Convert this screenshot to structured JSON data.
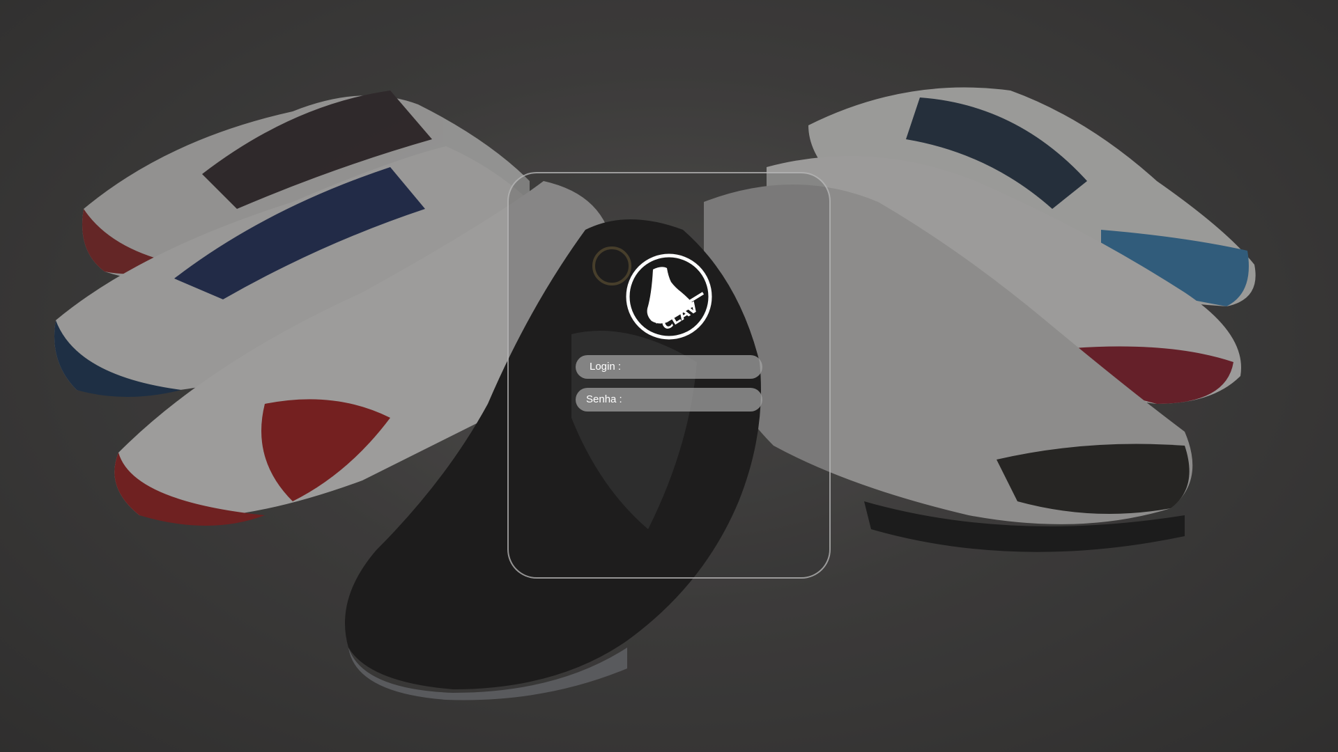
{
  "background": {
    "description_icon": "sneakers-background-image"
  },
  "brand": {
    "logo_text": "CLAV",
    "logo_icon": "sneaker-icon"
  },
  "form": {
    "login_label": "Login :",
    "login_value": "",
    "senha_label": "Senha :",
    "senha_value": ""
  },
  "colors": {
    "panel_border": "#bebebe",
    "field_bg": "#a5a5a5",
    "text": "#ffffff"
  }
}
